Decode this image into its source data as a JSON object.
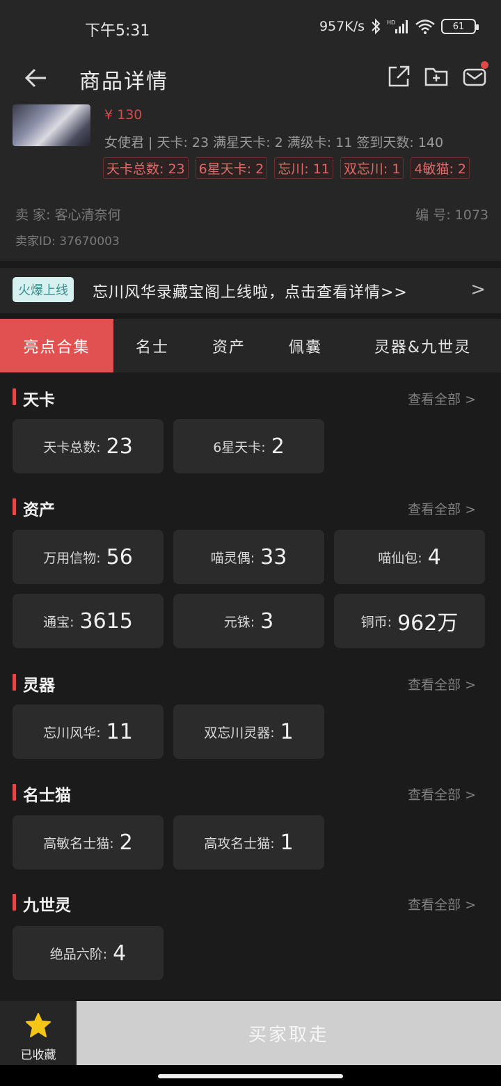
{
  "status": {
    "time": "下午5:31",
    "net_speed": "957K/s",
    "battery": "61"
  },
  "header": {
    "title": "商品详情"
  },
  "product": {
    "price": "¥ 130",
    "info": "女使君 | 天卡: 23  满星天卡: 2  满级卡: 11  签到天数: 140",
    "tags": [
      "天卡总数: 23",
      "6星天卡: 2",
      "忘川: 11",
      "双忘川: 1",
      "4敏猫: 2"
    ],
    "seller": "卖  家: 客心清奈何",
    "seller_id": "卖家ID: 37670003",
    "serial": "编  号: 1073"
  },
  "banner": {
    "badge": "火爆上线",
    "text": "忘川风华录藏宝阁上线啦，点击查看详情>>",
    "arrow": ">"
  },
  "tabs": [
    {
      "label": "亮点合集",
      "active": true
    },
    {
      "label": "名士"
    },
    {
      "label": "资产"
    },
    {
      "label": "佩囊"
    },
    {
      "label": "灵器&九世灵"
    }
  ],
  "more_label": "查看全部 >",
  "sections": [
    {
      "title": "天卡",
      "items": [
        {
          "label": "天卡总数:",
          "value": "23"
        },
        {
          "label": "6星天卡:",
          "value": "2"
        }
      ]
    },
    {
      "title": "资产",
      "items": [
        {
          "label": "万用信物:",
          "value": "56"
        },
        {
          "label": "喵灵偶:",
          "value": "33"
        },
        {
          "label": "喵仙包:",
          "value": "4"
        },
        {
          "label": "通宝:",
          "value": "3615"
        },
        {
          "label": "元铢:",
          "value": "3"
        },
        {
          "label": "铜币:",
          "value": "962万"
        }
      ]
    },
    {
      "title": "灵器",
      "items": [
        {
          "label": "忘川风华:",
          "value": "11"
        },
        {
          "label": "双忘川灵器:",
          "value": "1"
        }
      ]
    },
    {
      "title": "名士猫",
      "items": [
        {
          "label": "高敏名士猫:",
          "value": "2"
        },
        {
          "label": "高攻名士猫:",
          "value": "1"
        }
      ]
    },
    {
      "title": "九世灵",
      "items": [
        {
          "label": "绝品六阶:",
          "value": "4"
        }
      ]
    }
  ],
  "bottom": {
    "fav_label": "已收藏",
    "buy_label": "买家取走"
  },
  "colors": {
    "accent": "#e25151",
    "star": "#f5c518"
  }
}
